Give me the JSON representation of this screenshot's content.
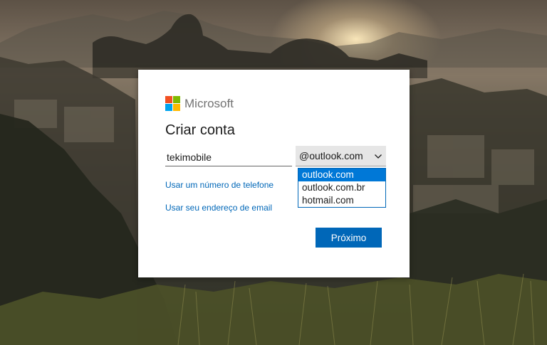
{
  "background": {
    "description_icon": "rio-de-janeiro-sunset-landscape"
  },
  "dialog": {
    "brand": {
      "name": "Microsoft",
      "logo_colors": [
        "#f25022",
        "#7fba00",
        "#00a4ef",
        "#ffb900"
      ]
    },
    "title": "Criar conta",
    "username": {
      "value": "tekimobile",
      "placeholder": ""
    },
    "domain": {
      "selected": "@outlook.com",
      "options": [
        "outlook.com",
        "outlook.com.br",
        "hotmail.com"
      ],
      "highlighted_option": "outlook.com"
    },
    "links": {
      "phone": "Usar um número de telefone",
      "email": "Usar seu endereço de email"
    },
    "next_label": "Próximo"
  },
  "colors": {
    "accent": "#0067b8",
    "highlight": "#0078d7"
  }
}
